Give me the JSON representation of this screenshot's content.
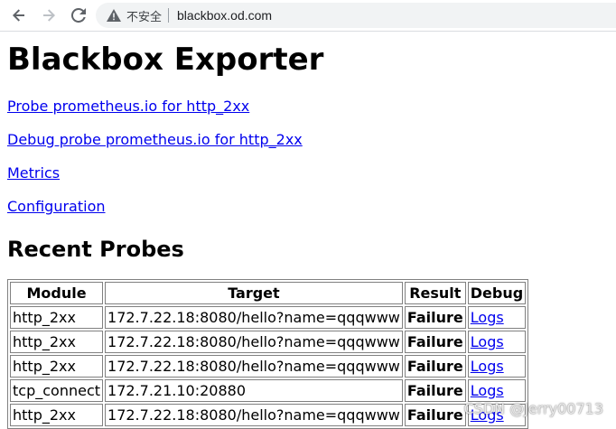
{
  "browser": {
    "security_label": "不安全",
    "url": "blackbox.od.com"
  },
  "page": {
    "title": "Blackbox Exporter",
    "links": [
      {
        "label": "Probe prometheus.io for http_2xx"
      },
      {
        "label": "Debug probe prometheus.io for http_2xx"
      },
      {
        "label": "Metrics"
      },
      {
        "label": "Configuration"
      }
    ],
    "recent_heading": "Recent Probes"
  },
  "table": {
    "headers": [
      "Module",
      "Target",
      "Result",
      "Debug"
    ],
    "rows": [
      {
        "module": "http_2xx",
        "target": "172.7.22.18:8080/hello?name=qqqwww",
        "result": "Failure",
        "debug": "Logs"
      },
      {
        "module": "http_2xx",
        "target": "172.7.22.18:8080/hello?name=qqqwww",
        "result": "Failure",
        "debug": "Logs"
      },
      {
        "module": "http_2xx",
        "target": "172.7.22.18:8080/hello?name=qqqwww",
        "result": "Failure",
        "debug": "Logs"
      },
      {
        "module": "tcp_connect",
        "target": "172.7.21.10:20880",
        "result": "Failure",
        "debug": "Logs"
      },
      {
        "module": "http_2xx",
        "target": "172.7.22.18:8080/hello?name=qqqwww",
        "result": "Failure",
        "debug": "Logs"
      }
    ]
  },
  "watermark": "CSDN @Jerry00713",
  "colors": {
    "link": "#0000ee",
    "border": "#808080",
    "omnibox_bg": "#f1f3f4"
  },
  "icons": {
    "back": "arrow-left-icon",
    "forward": "arrow-right-icon",
    "reload": "reload-icon",
    "security": "warning-triangle-icon"
  }
}
